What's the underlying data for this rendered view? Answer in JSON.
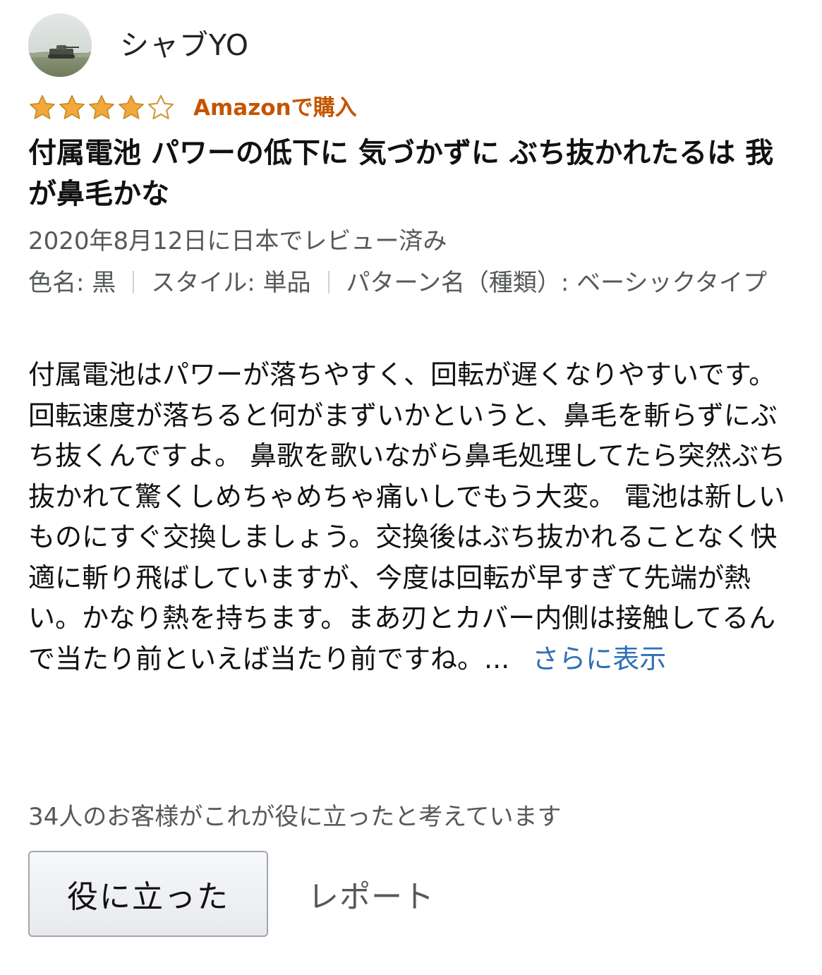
{
  "reviewer": {
    "name": "シャブYO",
    "avatar_icon": "tank-photo-avatar"
  },
  "rating": {
    "stars": 4,
    "max_stars": 5,
    "star_color": "#f2a83b",
    "verified_label": "Amazonで購入",
    "verified_color": "#c45500"
  },
  "review": {
    "title": "付属電池 パワーの低下に 気づかずに ぶち抜かれたるは 我が鼻毛かな",
    "date": "2020年8月12日に日本でレビュー済み",
    "variation": {
      "color": "色名: 黒",
      "style": "スタイル: 単品",
      "pattern": "パターン名（種類）: ベーシックタイプ"
    },
    "body": "付属電池はパワーが落ちやすく、回転が遅くなりやすいです。 回転速度が落ちると何がまずいかというと、鼻毛を斬らずにぶち抜くんですよ。 鼻歌を歌いながら鼻毛処理してたら突然ぶち抜かれて驚くしめちゃめちゃ痛いしでもう大変。 電池は新しいものにすぐ交換しましょう。交換後はぶち抜かれることなく快適に斬り飛ばしていますが、今度は回転が早すぎて先端が熱い。かなり熱を持ちます。まあ刃とカバー内側は接触してるんで当たり前といえば当たり前ですね。...",
    "read_more": "さらに表示",
    "link_color": "#2e6fb5"
  },
  "helpful": {
    "count_text": "34人のお客様がこれが役に立ったと考えています",
    "button_label": "役に立った",
    "report_label": "レポート"
  }
}
